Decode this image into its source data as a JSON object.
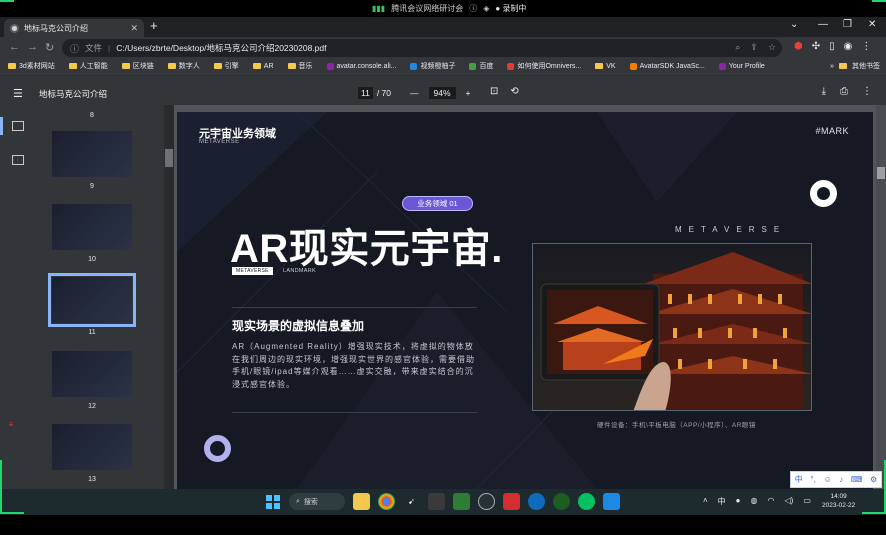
{
  "meeting": {
    "indicator": "腾讯会议网络研讨会",
    "recording": "录制中"
  },
  "browser": {
    "tab_title": "地标马克公司介绍",
    "new_tab": "+",
    "url_label": "文件",
    "url": "C:/Users/zbrte/Desktop/地标马克公司介绍20230208.pdf",
    "bookmarks": [
      {
        "label": "3d素材网站",
        "kind": "folder"
      },
      {
        "label": "人工智能",
        "kind": "folder"
      },
      {
        "label": "区块链",
        "kind": "folder"
      },
      {
        "label": "数字人",
        "kind": "folder"
      },
      {
        "label": "引擎",
        "kind": "folder"
      },
      {
        "label": "AR",
        "kind": "folder"
      },
      {
        "label": "音乐",
        "kind": "folder"
      },
      {
        "label": "avatar.console.ali...",
        "kind": "site"
      },
      {
        "label": "视频橙柚子",
        "kind": "site"
      },
      {
        "label": "百度",
        "kind": "site"
      },
      {
        "label": "如何使用Omnivers...",
        "kind": "site"
      },
      {
        "label": "VK",
        "kind": "folder"
      },
      {
        "label": "AvatarSDK JavaSc...",
        "kind": "site"
      },
      {
        "label": "Your Profile",
        "kind": "site"
      }
    ],
    "other_bookmarks": "其他书签"
  },
  "pdf": {
    "title": "地标马克公司介绍",
    "current_page": "11",
    "total_pages": "/ 70",
    "zoom": "94%",
    "thumbnails": [
      {
        "label": "8"
      },
      {
        "label": "9"
      },
      {
        "label": "10"
      },
      {
        "label": "11",
        "selected": true
      },
      {
        "label": "12"
      },
      {
        "label": "13"
      }
    ]
  },
  "slide": {
    "section_title": "元宇宙业务领域",
    "section_sub": "METAVERSE",
    "brand": "#MARK",
    "pill": "业务领域 01",
    "headline": "AR现实元宇宙.",
    "tag_metaverse": "METAVERSE",
    "tag_landmark": "LANDMARK",
    "metaverse_spaced": "METAVERSE",
    "subheading": "现实场景的虚拟信息叠加",
    "body": "AR（Augmented Reality）增强现实技术，将虚拟的物体放在我们周边的现实环境，增强现实世界的感官体验，需要借助手机/眼镜/ipad等媒介观看……虚实交融，带来虚实结合的沉浸式感官体验。",
    "caption": "硬件设备：手机\\平板电脑（APP/小程序）、AR眼镜"
  },
  "ime": [
    "中",
    "°,",
    "☺",
    "♪",
    "⌨",
    "⚙"
  ],
  "taskbar": {
    "search": "搜索",
    "time": "14:09",
    "date": "2023-02-22",
    "tray_lang": "中"
  },
  "colors": {
    "accent": "#8ab4f8",
    "pill": "#6c57d9",
    "slide_bg": "#151923",
    "ring_purple": "#b3b0ee"
  }
}
